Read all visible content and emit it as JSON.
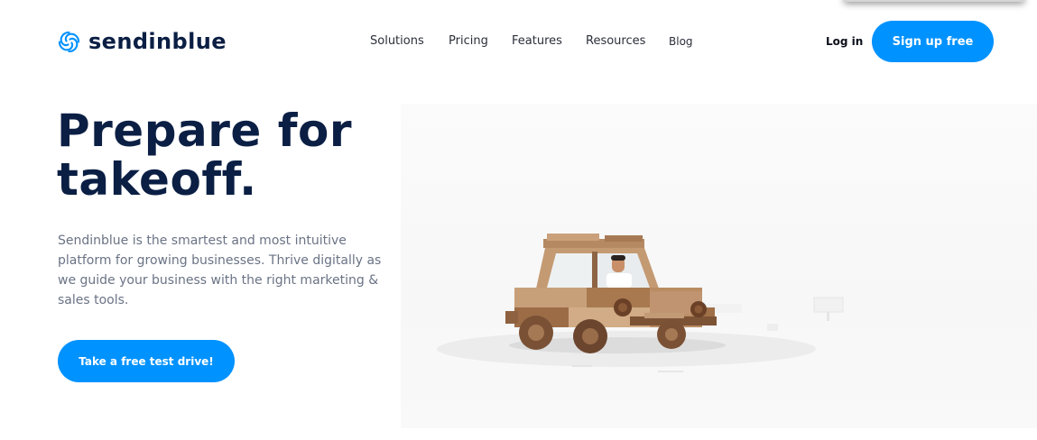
{
  "brand": {
    "name": "sendinblue",
    "icon": "sendinblue-swirl-logo-icon",
    "accent_color": "#0092ff",
    "text_color": "#0b1f44"
  },
  "nav": {
    "items": [
      "Solutions",
      "Pricing",
      "Features",
      "Resources",
      "Blog"
    ],
    "login": "Log in",
    "signup": "Sign up free"
  },
  "hero": {
    "title": "Prepare for takeoff.",
    "subtitle": "Sendinblue is the smartest and most intuitive platform for growing businesses. Thrive digitally as we guide your business with the right marketing & sales tools.",
    "cta": "Take a free test drive!",
    "illustration": "wooden-toy-car-with-driver-illustration"
  }
}
